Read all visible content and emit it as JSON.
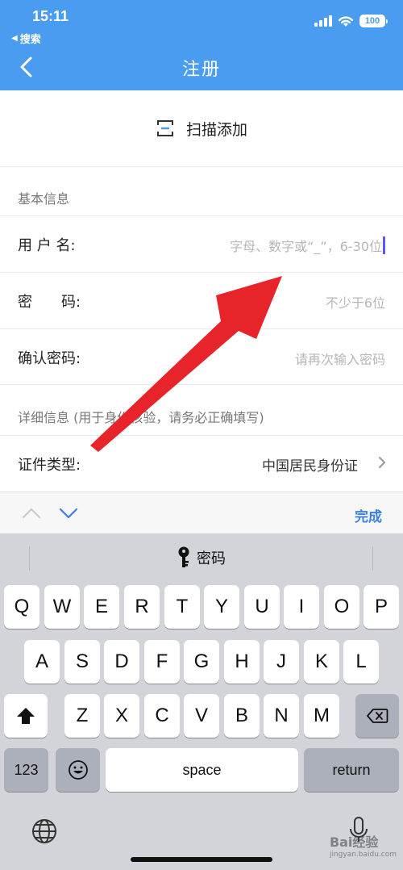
{
  "status_bar": {
    "time": "15:11",
    "back_app": "搜索",
    "battery": "100"
  },
  "nav": {
    "title": "注册"
  },
  "scan": {
    "label": "扫描添加"
  },
  "basic_section": {
    "title": "基本信息"
  },
  "fields": [
    {
      "label": "用 户 名:",
      "placeholder": "字母、数字或“_”，6-30位"
    },
    {
      "label": "密　　码:",
      "placeholder": "不少于6位"
    },
    {
      "label": "确认密码:",
      "placeholder": "请再次输入密码"
    }
  ],
  "detail_section": {
    "title": "详细信息 (用于身份核验，请务必正确填写)"
  },
  "id_type": {
    "label": "证件类型:",
    "value": "中国居民身份证"
  },
  "accessory": {
    "done_label": "完成"
  },
  "keyboard": {
    "suggestion": "密码",
    "row1": [
      "Q",
      "W",
      "E",
      "R",
      "T",
      "Y",
      "U",
      "I",
      "O",
      "P"
    ],
    "row2": [
      "A",
      "S",
      "D",
      "F",
      "G",
      "H",
      "J",
      "K",
      "L"
    ],
    "row3": [
      "Z",
      "X",
      "C",
      "V",
      "B",
      "N",
      "M"
    ],
    "numbers_label": "123",
    "space_label": "space",
    "return_label": "return"
  },
  "watermark": {
    "brand": "Bai经验",
    "url": "jingyan.baidu.com"
  },
  "colors": {
    "nav_bar": "#4a9cf0",
    "done": "#3d7fe0",
    "arrow": "#e8242b",
    "cursor": "#5b5bf0"
  }
}
